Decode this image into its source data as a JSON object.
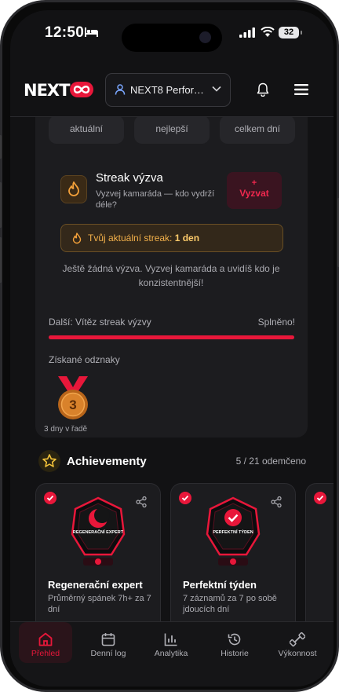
{
  "status": {
    "time": "12:50",
    "battery": "32"
  },
  "header": {
    "logo": "NEXT",
    "selector_label": "NEXT8 Perfor…"
  },
  "stats": {
    "chips": [
      "aktuální",
      "nejlepší",
      "celkem dní"
    ]
  },
  "streak": {
    "title": "Streak výzva",
    "description": "Vyzvej kamaráda — kdo vydrží déle?",
    "challenge_plus": "+",
    "challenge_label": "Vyzvat",
    "current_prefix": "Tvůj aktuální streak: ",
    "current_value": "1 den",
    "empty_message": "Ještě žádná výzva. Vyzvej kamaráda a uvidíš kdo je konzistentnější!",
    "next_label": "Další: Vítěz streak výzvy",
    "done_label": "Splněno!",
    "progress": 1.0
  },
  "badges": {
    "label": "Získané odznaky",
    "items": [
      {
        "number": "3",
        "label": "3 dny v řadě"
      }
    ]
  },
  "achievements": {
    "title": "Achievementy",
    "count": "5 / 21 odemčeno",
    "cards": [
      {
        "badge_text": "REGENERAČNÍ EXPERT",
        "name": "Regenerační expert",
        "description": "Průměrný spánek 7h+ za 7 dní"
      },
      {
        "badge_text": "PERFEKTNÍ TÝDEN",
        "name": "Perfektní týden",
        "description": "7 záznamů za 7 po sobě jdoucích dní"
      }
    ]
  },
  "nav": {
    "items": [
      {
        "label": "Přehled",
        "icon": "home-icon",
        "active": true
      },
      {
        "label": "Denní log",
        "icon": "calendar-icon"
      },
      {
        "label": "Analytika",
        "icon": "bar-chart-icon"
      },
      {
        "label": "Historie",
        "icon": "history-icon"
      },
      {
        "label": "Výkonnost",
        "icon": "dumbbell-icon"
      }
    ]
  },
  "colors": {
    "accent": "#e8173a",
    "streak": "#f2b04a",
    "background": "#121214"
  }
}
